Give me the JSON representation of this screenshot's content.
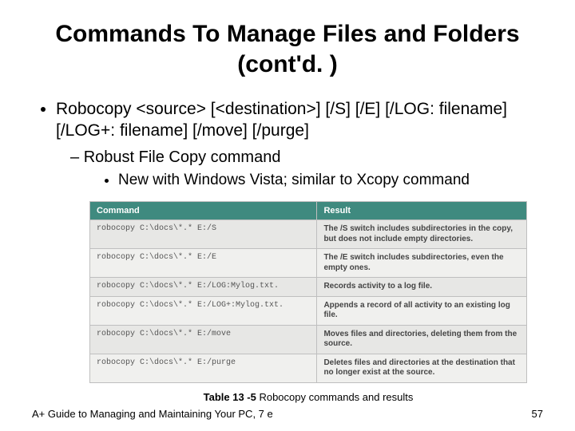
{
  "title": "Commands To Manage Files and Folders (cont'd. )",
  "bullets": {
    "main": "Robocopy <source> [<destination>] [/S] [/E] [/LOG: filename] [/LOG+: filename] [/move] [/purge]",
    "sub1": "Robust File Copy command",
    "sub2": "New with Windows Vista; similar to Xcopy command"
  },
  "chart_data": {
    "type": "table",
    "headers": [
      "Command",
      "Result"
    ],
    "rows": [
      {
        "command": "robocopy C:\\docs\\*.* E:/S",
        "result": "The /S switch includes subdirectories in the copy, but does not include empty directories."
      },
      {
        "command": "robocopy C:\\docs\\*.* E:/E",
        "result": "The /E switch includes subdirectories, even the empty ones."
      },
      {
        "command": "robocopy C:\\docs\\*.* E:/LOG:Mylog.txt.",
        "result": "Records activity to a log file."
      },
      {
        "command": "robocopy C:\\docs\\*.* E:/LOG+:Mylog.txt.",
        "result": "Appends a record of all activity to an existing log file."
      },
      {
        "command": "robocopy C:\\docs\\*.* E:/move",
        "result": "Moves files and directories, deleting them from the source."
      },
      {
        "command": "robocopy C:\\docs\\*.* E:/purge",
        "result": "Deletes files and directories at the destination that no longer exist at the source."
      }
    ]
  },
  "caption": {
    "label": "Table 13 -5",
    "text": " Robocopy commands and results"
  },
  "footer": {
    "left": "A+ Guide to Managing and Maintaining Your PC, 7 e",
    "right": "57"
  }
}
